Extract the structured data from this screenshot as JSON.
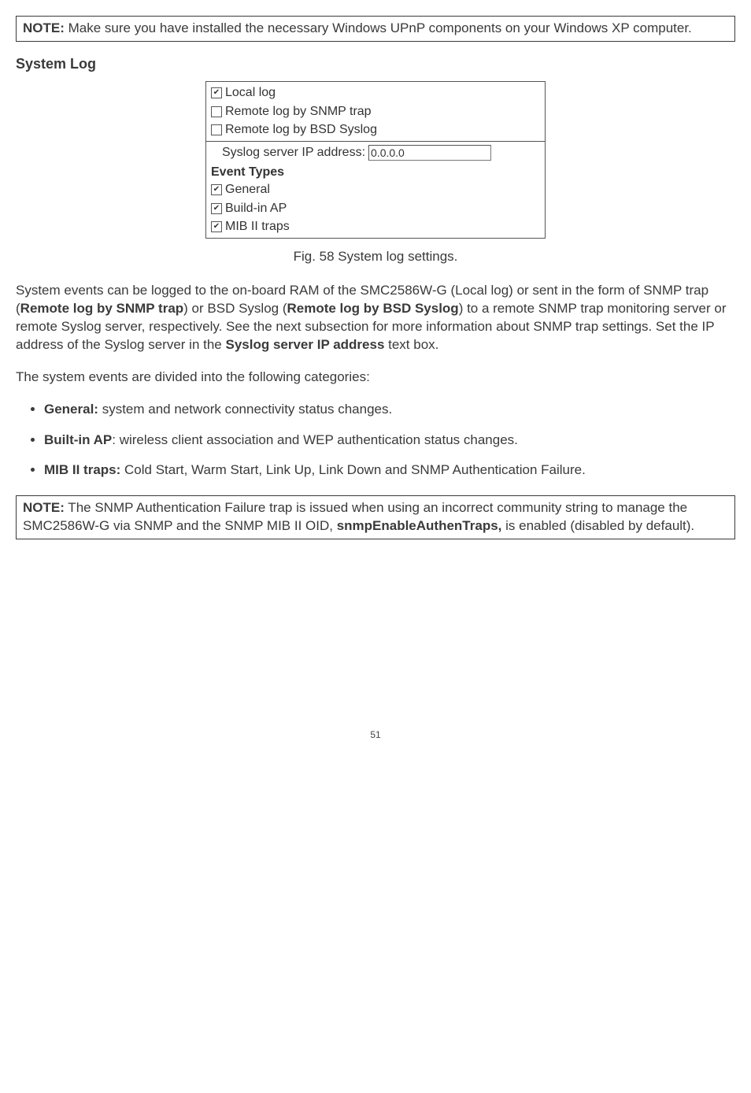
{
  "note1": {
    "label": "NOTE:",
    "text": " Make sure you have installed the necessary Windows UPnP components on your Windows XP computer."
  },
  "heading": "System Log",
  "figure": {
    "rows": {
      "local": {
        "checked": true,
        "label": "Local log"
      },
      "snmp": {
        "checked": false,
        "label": "Remote log by SNMP trap"
      },
      "bsd": {
        "checked": false,
        "label": "Remote log by BSD Syslog"
      },
      "ip_label": "Syslog server IP address:",
      "ip_value": "0.0.0.0",
      "event_head": "Event Types",
      "general": {
        "checked": true,
        "label": "General"
      },
      "buildin": {
        "checked": true,
        "label": "Build-in AP"
      },
      "mib": {
        "checked": true,
        "label": "MIB II traps"
      }
    },
    "caption": "Fig. 58 System log settings."
  },
  "para1": {
    "pre": "System events can be logged to the on-board RAM of the SMC2586W-G (Local log) or sent in the form of SNMP trap (",
    "b1": "Remote log by SNMP trap",
    "mid1": ") or BSD Syslog (",
    "b2": "Remote log by BSD Syslog",
    "mid2": ") to a remote SNMP trap monitoring server or remote Syslog server, respectively. See the next subsection for more information about SNMP trap settings. Set the IP address of the Syslog server in the ",
    "b3": "Syslog server IP address",
    "post": " text box."
  },
  "para2": "The system events are divided into the following categories:",
  "bullets": {
    "b1": {
      "bold": "General:",
      "text": " system and network connectivity status changes."
    },
    "b2": {
      "bold": "Built-in AP",
      "colon": ": ",
      "text": "wireless client association and WEP authentication status changes."
    },
    "b3": {
      "bold": "MIB II traps:",
      "text": " Cold Start, Warm Start, Link Up, Link Down and SNMP Authentication Failure."
    }
  },
  "note2": {
    "label": "NOTE:",
    "pre": " The SNMP Authentication Failure trap is issued when using an incorrect community string to manage the SMC2586W-G via SNMP and the SNMP MIB II OID, ",
    "bold": "snmpEnableAuthenTraps,",
    "post": " is enabled (disabled by default)."
  },
  "page_num": "51"
}
